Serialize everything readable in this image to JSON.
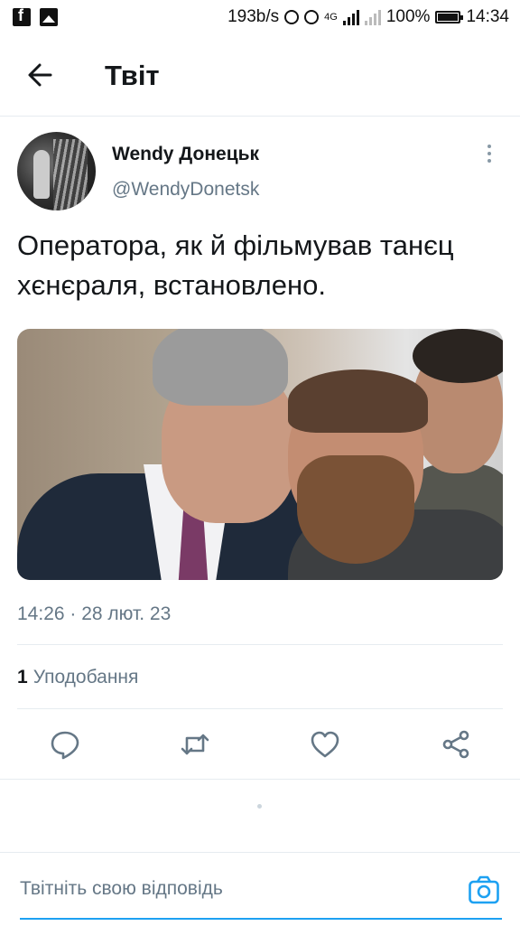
{
  "status_bar": {
    "speed": "193b/s",
    "network": "4G",
    "battery": "100%",
    "time": "14:34"
  },
  "header": {
    "title": "Твіт",
    "back_icon": "arrow-left-icon"
  },
  "tweet": {
    "author_name": "Wendy Донецьк",
    "handle": "@WendyDonetsk",
    "text": "Оператора, як й фільмував танєц хєнєраля, встановлено.",
    "timestamp": "14:26 · 28 лют. 23",
    "likes_count": "1",
    "likes_label": "Уподобання"
  },
  "actions": [
    "reply-icon",
    "retweet-icon",
    "like-icon",
    "share-icon"
  ],
  "reply_bar": {
    "placeholder": "Твітніть свою відповідь",
    "camera_icon": "camera-icon"
  },
  "colors": {
    "accent": "#1da1f2",
    "secondary_text": "#657786",
    "divider": "#e6ecf0"
  }
}
